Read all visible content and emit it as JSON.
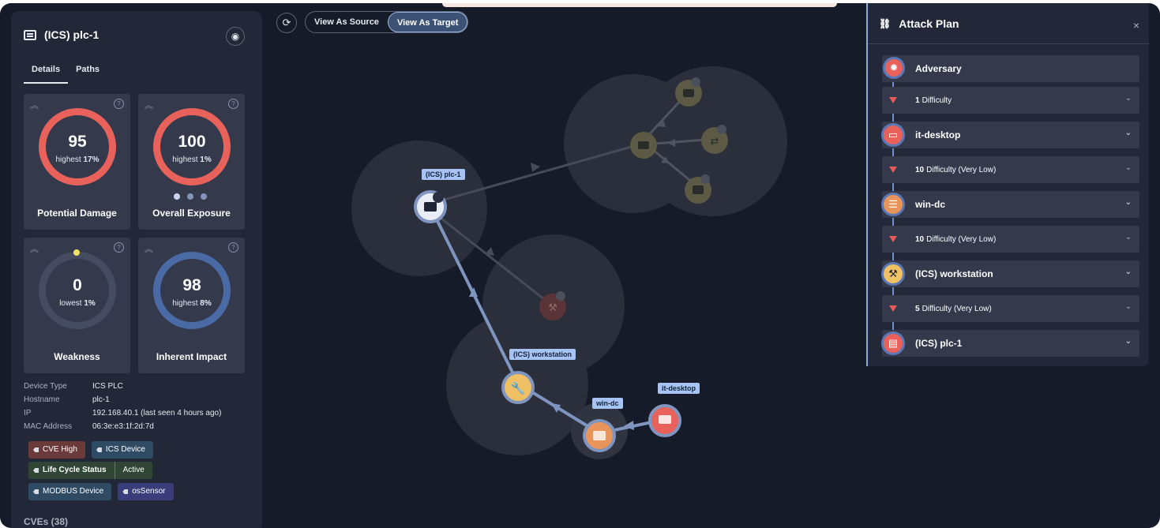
{
  "device": {
    "title": "(ICS) plc-1",
    "tabs": [
      "Details",
      "Paths"
    ]
  },
  "metrics": [
    {
      "value": "95",
      "prefix": "highest",
      "pct": "17%",
      "label": "Potential Damage",
      "color": "#e8625b"
    },
    {
      "value": "100",
      "prefix": "highest",
      "pct": "1%",
      "label": "Overall Exposure",
      "color": "#e8625b"
    },
    {
      "value": "0",
      "prefix": "lowest",
      "pct": "1%",
      "label": "Weakness",
      "color": "#454c60"
    },
    {
      "value": "98",
      "prefix": "highest",
      "pct": "8%",
      "label": "Inherent Impact",
      "color": "#4a6aa6"
    }
  ],
  "properties": [
    {
      "key": "Device Type",
      "value": "ICS PLC"
    },
    {
      "key": "Hostname",
      "value": "plc-1"
    },
    {
      "key": "IP",
      "value": "192.168.40.1 (last seen 4 hours ago)"
    },
    {
      "key": "MAC Address",
      "value": "06:3e:e3:1f:2d:7d"
    }
  ],
  "tags": {
    "cve": "CVE High",
    "ics": "ICS Device",
    "lifecycle_key": "Life Cycle Status",
    "lifecycle_val": "Active",
    "modbus": "MODBUS Device",
    "os": "osSensor"
  },
  "cves_heading": "CVEs (38)",
  "graph": {
    "view_source": "View As Source",
    "view_target": "View As Target",
    "labels": {
      "plc": "(ICS) plc-1",
      "workstation": "(ICS) workstation",
      "windc": "win-dc",
      "desktop": "it-desktop"
    }
  },
  "plan": {
    "title": "Attack Plan",
    "close": "×",
    "nodes": [
      {
        "name": "Adversary",
        "color": "#e8625b",
        "icon": "gear-icon"
      },
      {
        "name": "it-desktop",
        "color": "#e8625b",
        "icon": "monitor-icon"
      },
      {
        "name": "win-dc",
        "color": "#e8955b",
        "icon": "server-icon"
      },
      {
        "name": "(ICS) workstation",
        "color": "#f0c064",
        "icon": "wrench-icon"
      },
      {
        "name": "(ICS) plc-1",
        "color": "#e8625b",
        "icon": "device-icon"
      }
    ],
    "difficulties": [
      {
        "num": "1",
        "text": "Difficulty"
      },
      {
        "num": "10",
        "text": "Difficulty (Very Low)"
      },
      {
        "num": "10",
        "text": "Difficulty (Very Low)"
      },
      {
        "num": "5",
        "text": "Difficulty (Very Low)"
      }
    ]
  }
}
